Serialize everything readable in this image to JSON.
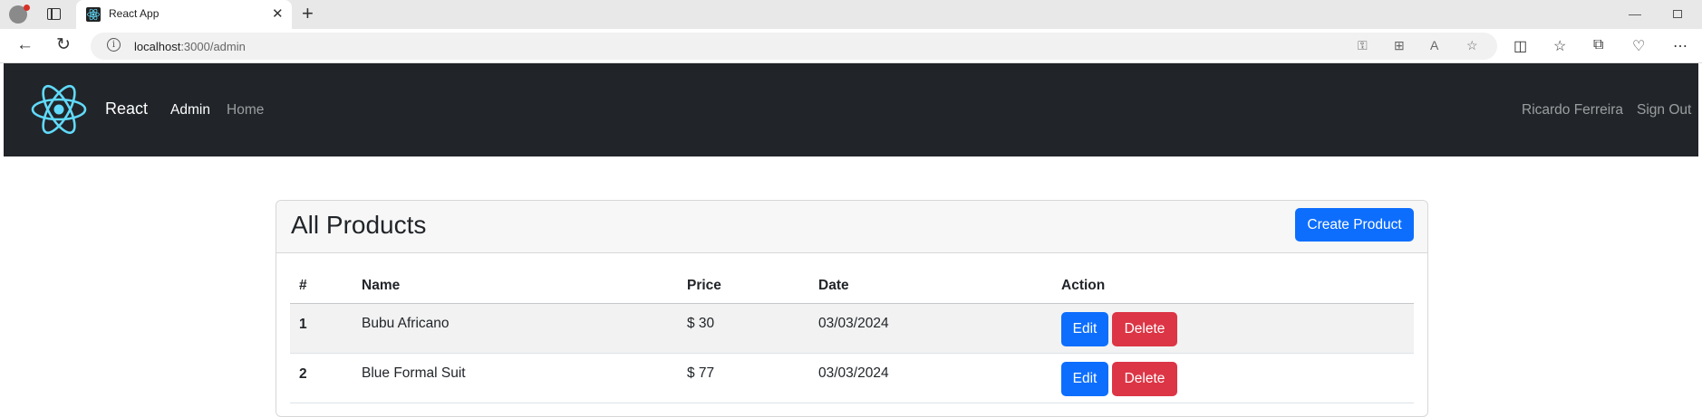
{
  "browser": {
    "tab_title": "React App",
    "url_host": "localhost",
    "url_path": ":3000/admin"
  },
  "navbar": {
    "brand": "React",
    "links": [
      "Admin",
      "Home"
    ],
    "user_name": "Ricardo Ferreira",
    "sign_out": "Sign Out"
  },
  "card": {
    "title": "All Products",
    "create_button": "Create Product"
  },
  "table": {
    "headers": [
      "#",
      "Name",
      "Price",
      "Date",
      "Action"
    ],
    "rows": [
      {
        "id": "1",
        "name": "Bubu Africano",
        "price": "$ 30",
        "date": "03/03/2024",
        "edit": "Edit",
        "delete": "Delete"
      },
      {
        "id": "2",
        "name": "Blue Formal Suit",
        "price": "$ 77",
        "date": "03/03/2024",
        "edit": "Edit",
        "delete": "Delete"
      }
    ]
  },
  "colors": {
    "navbar_bg": "#212529",
    "primary": "#0d6efd",
    "danger": "#dc3545",
    "react_cyan": "#61dafb"
  }
}
